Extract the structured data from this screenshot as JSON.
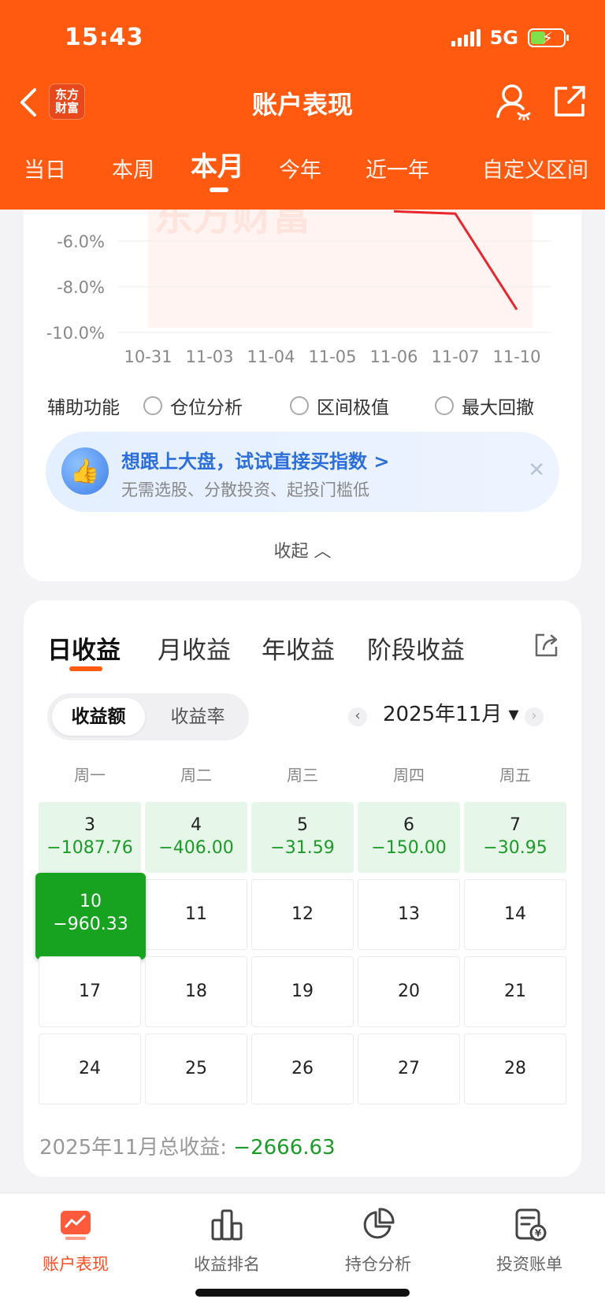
{
  "status_bar": {
    "time": "15:43",
    "network": "5G"
  },
  "header": {
    "title": "账户表现",
    "logo_line1": "东方",
    "logo_line2": "财富"
  },
  "period_tabs": [
    "当日",
    "本周",
    "本月",
    "今年",
    "近一年",
    "自定义区间"
  ],
  "period_active_index": 2,
  "chart_data": {
    "type": "line",
    "x": [
      "10-31",
      "11-03",
      "11-04",
      "11-05",
      "11-06",
      "11-07",
      "11-10"
    ],
    "y_tick_labels": [
      "-6.0%",
      "-8.0%",
      "-10.0%"
    ],
    "visible_series_points": [
      [
        "11-06",
        -4.7
      ],
      [
        "11-07",
        -4.8
      ],
      [
        "11-10",
        -9.0
      ]
    ],
    "line_color": "#e8262b",
    "watermark": "东方财富"
  },
  "aux": {
    "label": "辅助功能",
    "options": [
      "仓位分析",
      "区间极值",
      "最大回撤"
    ]
  },
  "promo": {
    "title": "想跟上大盘，试试直接买指数 >",
    "subtitle": "无需选股、分散投资、起投门槛低",
    "close": "✕"
  },
  "collapse_label": "收起 ︿",
  "earn_tabs": [
    "日收益",
    "月收益",
    "年收益",
    "阶段收益"
  ],
  "toggle": {
    "amount": "收益额",
    "rate": "收益率"
  },
  "month_label": "2025年11月 ▾",
  "weekdays": [
    "周一",
    "周二",
    "周三",
    "周四",
    "周五"
  ],
  "calendar": [
    [
      {
        "day": "3",
        "value": "−1087.76"
      },
      {
        "day": "4",
        "value": "−406.00"
      },
      {
        "day": "5",
        "value": "−31.59"
      },
      {
        "day": "6",
        "value": "−150.00"
      },
      {
        "day": "7",
        "value": "−30.95"
      }
    ],
    [
      {
        "day": "10",
        "value": "−960.33"
      },
      {
        "day": "11",
        "value": ""
      },
      {
        "day": "12",
        "value": ""
      },
      {
        "day": "13",
        "value": ""
      },
      {
        "day": "14",
        "value": ""
      }
    ],
    [
      {
        "day": "17",
        "value": ""
      },
      {
        "day": "18",
        "value": ""
      },
      {
        "day": "19",
        "value": ""
      },
      {
        "day": "20",
        "value": ""
      },
      {
        "day": "21",
        "value": ""
      }
    ],
    [
      {
        "day": "24",
        "value": ""
      },
      {
        "day": "25",
        "value": ""
      },
      {
        "day": "26",
        "value": ""
      },
      {
        "day": "27",
        "value": ""
      },
      {
        "day": "28",
        "value": ""
      }
    ]
  ],
  "total": {
    "label": "2025年11月总收益: ",
    "value": "−2666.63"
  },
  "bottom_nav": [
    {
      "label": "账户表现",
      "icon": "account-performance-icon"
    },
    {
      "label": "收益排名",
      "icon": "ranking-icon"
    },
    {
      "label": "持仓分析",
      "icon": "pie-chart-icon"
    },
    {
      "label": "投资账单",
      "icon": "bill-icon"
    }
  ],
  "colors": {
    "brand_orange": "#ff5a10",
    "gain_green": "#1a9c27",
    "loss_line": "#e8262b"
  }
}
